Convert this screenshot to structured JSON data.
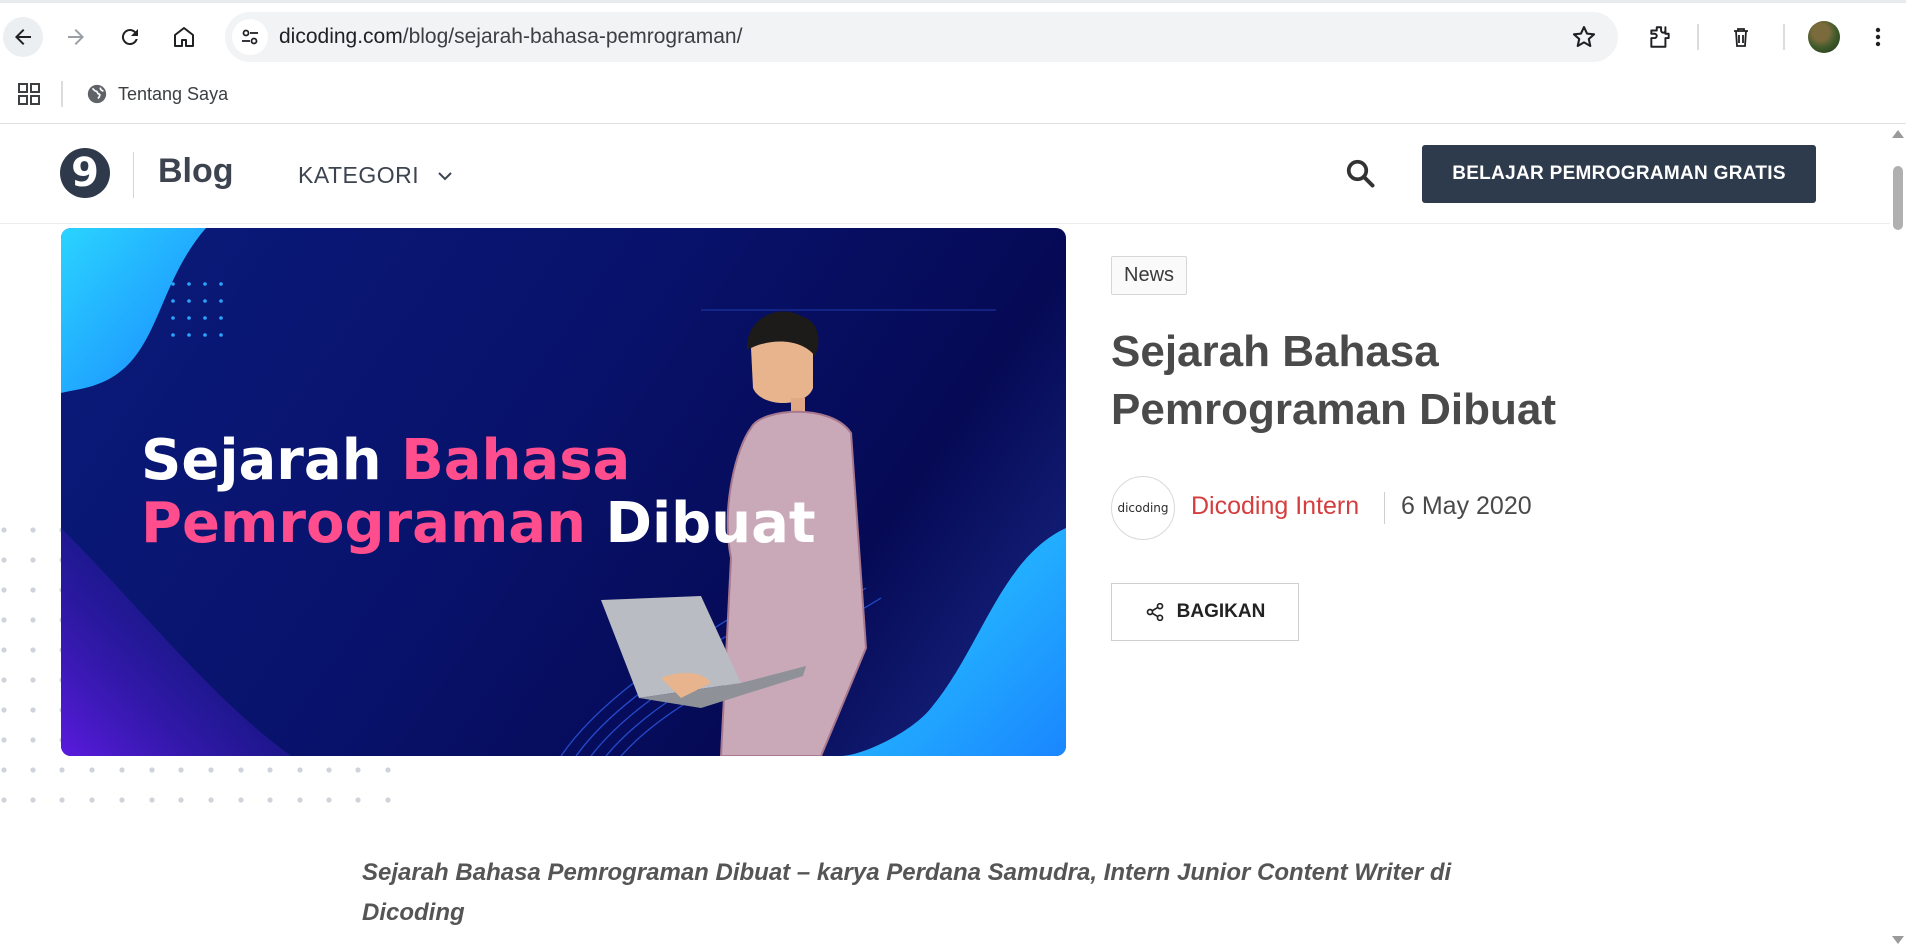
{
  "browser": {
    "url_domain": "dicoding.com",
    "url_path": "/blog/sejarah-bahasa-pemrograman/",
    "bookmarks": [
      {
        "label": "Tentang Saya",
        "icon": "globe-icon"
      }
    ],
    "icons": [
      "back-arrow-icon",
      "forward-arrow-icon",
      "reload-icon",
      "home-icon",
      "site-settings-icon",
      "star-icon",
      "extensions-icon",
      "trash-icon",
      "profile-avatar",
      "kebab-menu-icon",
      "apps-grid-icon"
    ]
  },
  "site": {
    "logo_glyph": "9",
    "section": "Blog",
    "nav_category": "KATEGORI",
    "cta_label": "BELAJAR PEMROGRAMAN GRATIS",
    "colors": {
      "primary": "#2e3b4c",
      "author": "#d43e3e",
      "hero_pink": "#ff4d8d"
    }
  },
  "hero": {
    "line1_a": "Sejarah ",
    "line1_b": "Bahasa",
    "line2_a": "Pemrograman",
    "line2_b": " Dibuat"
  },
  "article": {
    "tag": "News",
    "title": "Sejarah Bahasa Pemrograman Dibuat",
    "author_logo_text": "dicoding",
    "author": "Dicoding Intern",
    "date": "6 May 2020",
    "share_label": "BAGIKAN",
    "intro": "Sejarah Bahasa Pemrograman Dibuat – karya Perdana Samudra, Intern Junior Content Writer di Dicoding"
  }
}
